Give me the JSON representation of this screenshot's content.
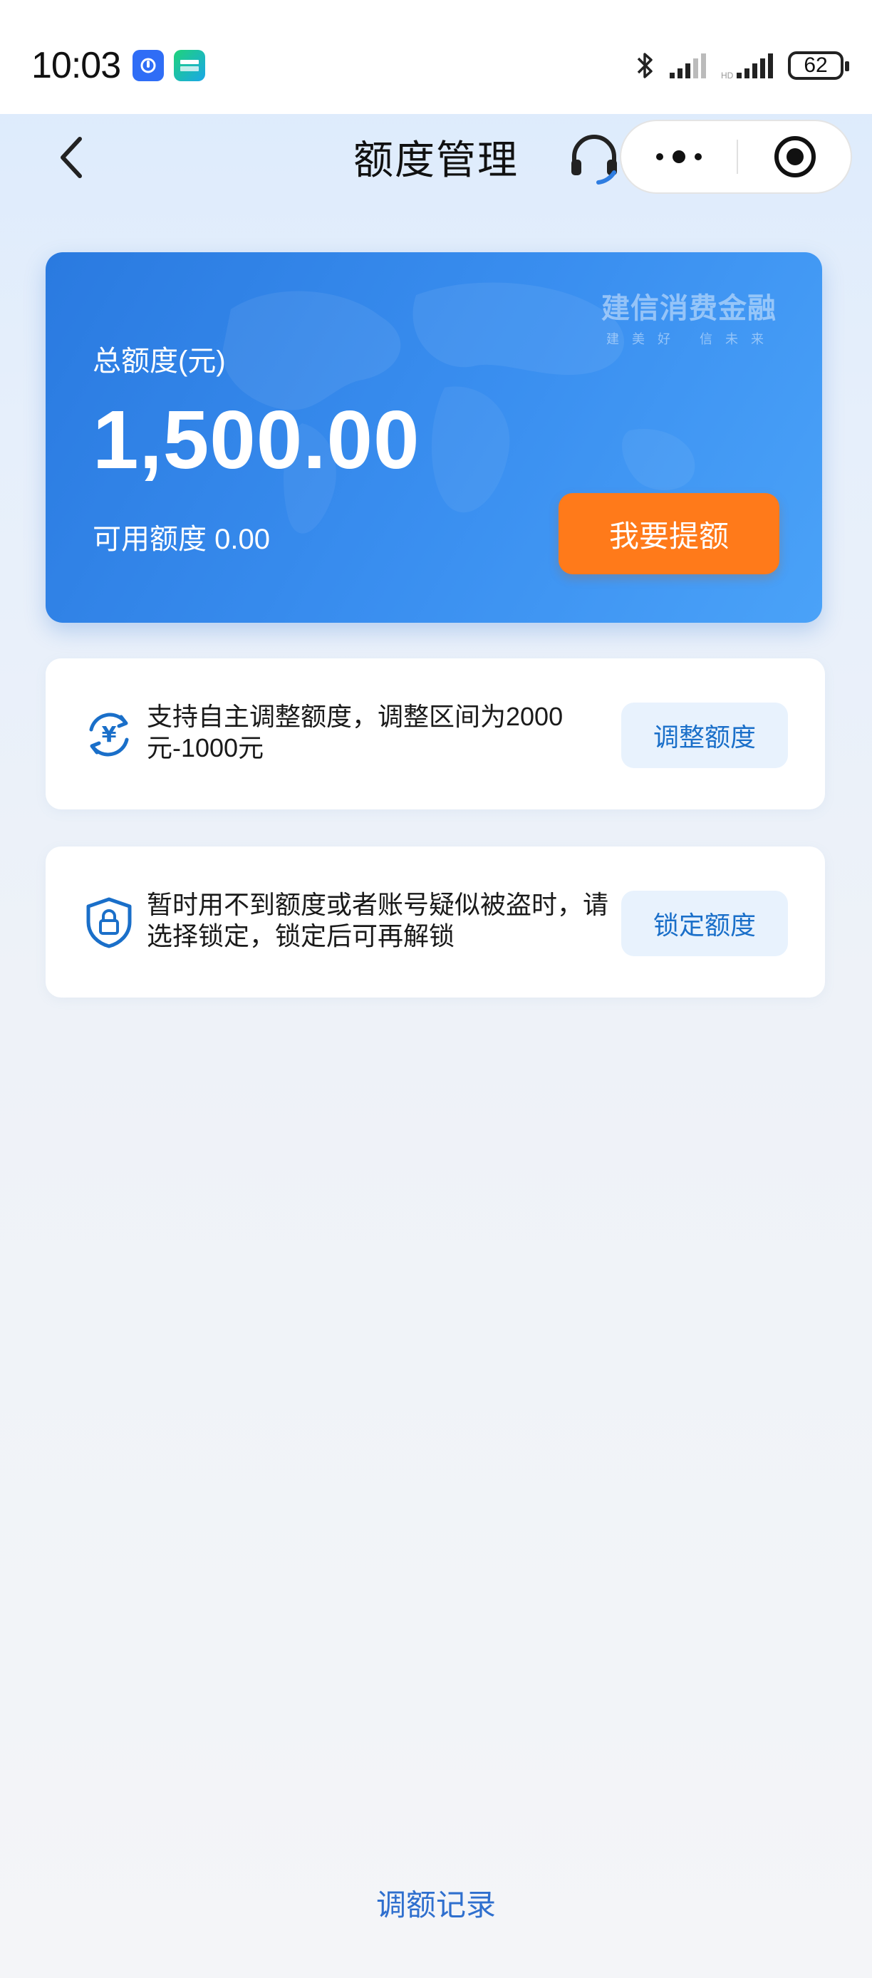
{
  "status_bar": {
    "time": "10:03",
    "battery": "62",
    "app_badges": [
      "app-badge-blue",
      "iqiyi-badge"
    ],
    "icons": [
      "bluetooth-icon",
      "signal-icon",
      "signal-icon"
    ]
  },
  "nav": {
    "title": "额度管理"
  },
  "credit_card": {
    "brand_name": "建信消费金融",
    "brand_slogan": "建美好 信未来",
    "total_label": "总额度(元)",
    "total_amount": "1,500.00",
    "available_label": "可用额度 0.00",
    "raise_button": "我要提额"
  },
  "adjust": {
    "text": "支持自主调整额度，调整区间为2000元-1000元",
    "button": "调整额度"
  },
  "lock": {
    "text": "暂时用不到额度或者账号疑似被盗时，请选择锁定，锁定后可再解锁",
    "button": "锁定额度"
  },
  "footer": {
    "history_link": "调额记录"
  },
  "colors": {
    "card_blue": "#2a7ae0",
    "accent_orange": "#ff7a1a",
    "link_blue": "#2f6fce",
    "button_tint": "#e8f2fd"
  }
}
